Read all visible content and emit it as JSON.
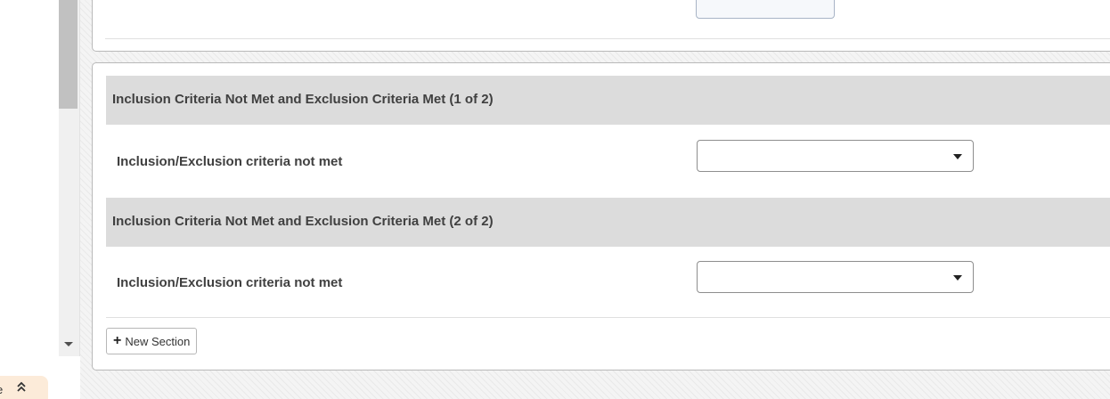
{
  "pill": {
    "text": "e",
    "icon": "chevron-up-double-icon",
    "bg_color": "#fcebd9"
  },
  "sections": [
    {
      "title": "Inclusion Criteria Not Met and Exclusion Criteria Met (1 of 2)",
      "field_label": "Inclusion/Exclusion criteria not met",
      "select_value": ""
    },
    {
      "title": "Inclusion Criteria Not Met and Exclusion Criteria Met (2 of 2)",
      "field_label": "Inclusion/Exclusion criteria not met",
      "select_value": ""
    }
  ],
  "toolbar": {
    "new_section_label": "New Section",
    "new_section_icon": "plus-icon"
  },
  "colors": {
    "section_header_bg": "#dcdcdc",
    "text": "#404040"
  }
}
